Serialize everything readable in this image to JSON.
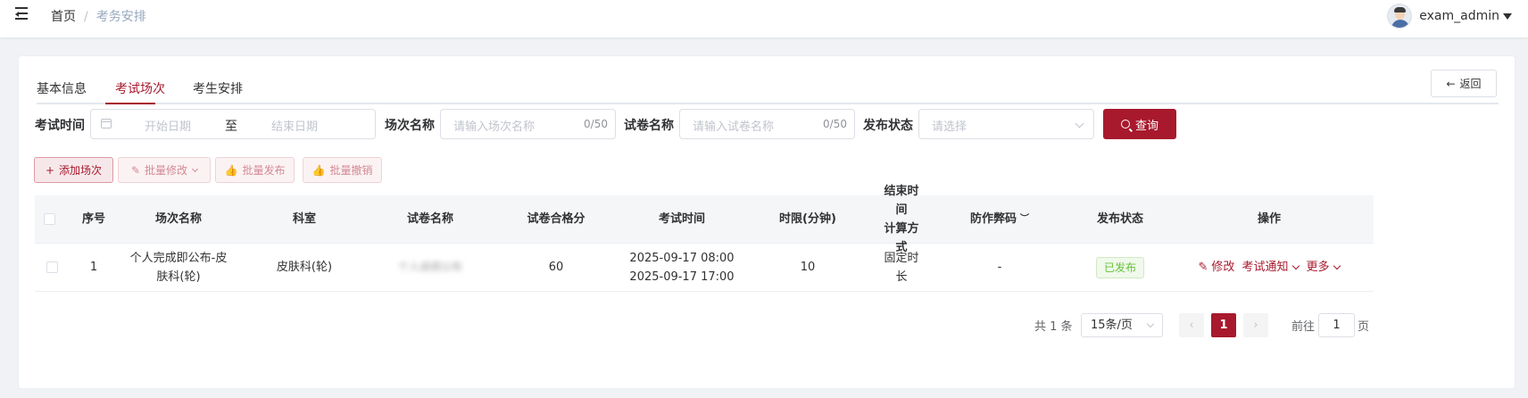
{
  "breadcrumb": {
    "home": "首页",
    "separator": "/",
    "current": "考务安排"
  },
  "user": {
    "name": "exam_admin"
  },
  "tabs": [
    {
      "label": "基本信息",
      "active": false
    },
    {
      "label": "考试场次",
      "active": true
    },
    {
      "label": "考生安排",
      "active": false
    }
  ],
  "back_button": {
    "label": "返回",
    "icon": "arrow-left-icon"
  },
  "filters": {
    "exam_time": {
      "label": "考试时间",
      "start_placeholder": "开始日期",
      "separator": "至",
      "end_placeholder": "结束日期"
    },
    "session_name": {
      "label": "场次名称",
      "placeholder": "请输入场次名称",
      "count": "0/50"
    },
    "paper_name": {
      "label": "试卷名称",
      "placeholder": "请输入试卷名称",
      "count": "0/50"
    },
    "publish_status": {
      "label": "发布状态",
      "placeholder": "请选择"
    },
    "query_label": "查询"
  },
  "actions": {
    "add": "添加场次",
    "batch_edit": "批量修改",
    "batch_publish": "批量发布",
    "batch_revoke": "批量撤销"
  },
  "table": {
    "headers": {
      "index": "序号",
      "session_name": "场次名称",
      "department": "科室",
      "paper_name": "试卷名称",
      "pass_score": "试卷合格分",
      "exam_time": "考试时间",
      "duration": "时限(分钟)",
      "end_calc_line1": "结束时间",
      "end_calc_line2": "计算方式",
      "anti_cheat": "防作弊码",
      "status": "发布状态",
      "ops": "操作"
    },
    "rows": [
      {
        "index": "1",
        "session_name": "个人完成即公布-皮肤科(轮)",
        "department": "皮肤科(轮)",
        "paper_name": "个人成绩公布",
        "pass_score": "60",
        "exam_start": "2025-09-17 08:00",
        "exam_end": "2025-09-17 17:00",
        "duration": "10",
        "end_calc": "固定时长",
        "anti_cheat": "-",
        "status": "已发布",
        "op_edit": "修改",
        "op_notice": "考试通知",
        "op_more": "更多"
      }
    ]
  },
  "pagination": {
    "total_text": "共 1 条",
    "page_size": "15条/页",
    "current_page": "1",
    "goto_label": "前往",
    "goto_value": "1",
    "page_suffix": "页"
  },
  "colors": {
    "accent": "#a8192d",
    "success": "#67c23a"
  }
}
